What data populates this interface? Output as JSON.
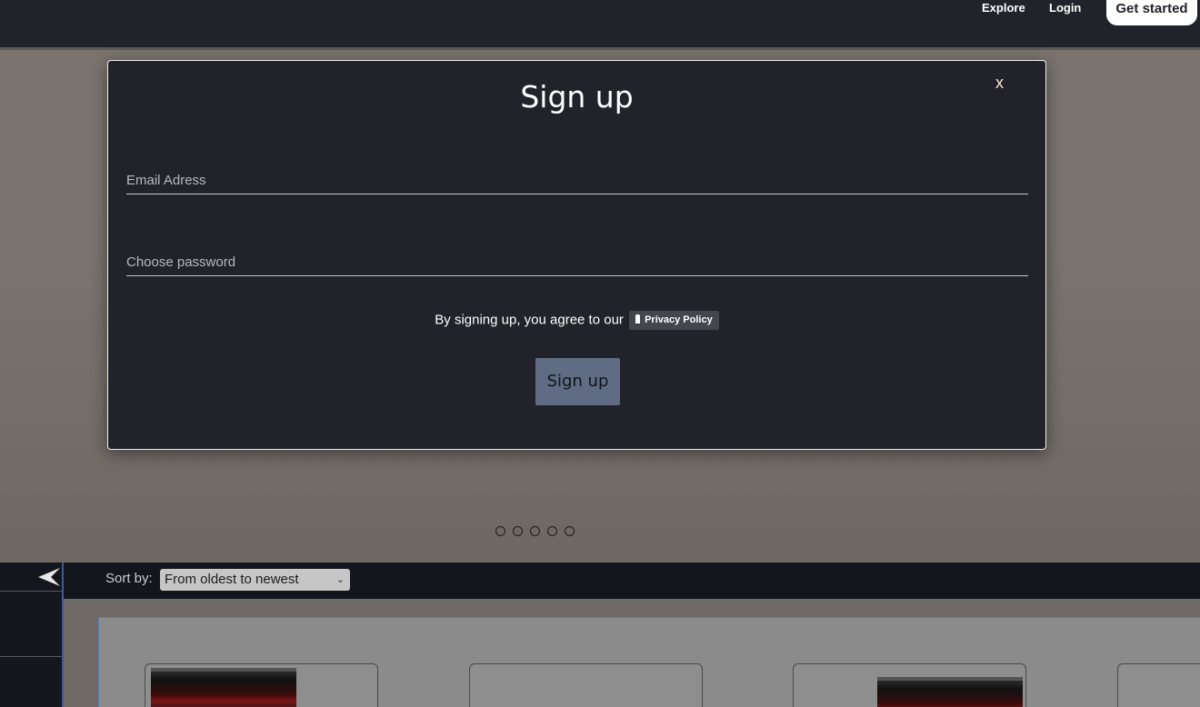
{
  "nav": {
    "explore": "Explore",
    "login": "Login",
    "get_started": "Get started"
  },
  "modal": {
    "title": "Sign up",
    "close": "x",
    "email_placeholder": "Email Adress",
    "password_placeholder": "Choose password",
    "agree_text": "By signing up, you agree to our",
    "policy_label": "Privacy Policy",
    "submit": "Sign up"
  },
  "carousel": {
    "slide_count": 5
  },
  "filter": {
    "sort_label": "Sort by:",
    "sort_value": "From oldest to newest"
  },
  "icons": {
    "back": "back-arrow-icon",
    "lock": "lock-icon",
    "select": "chevron-down-icon"
  }
}
